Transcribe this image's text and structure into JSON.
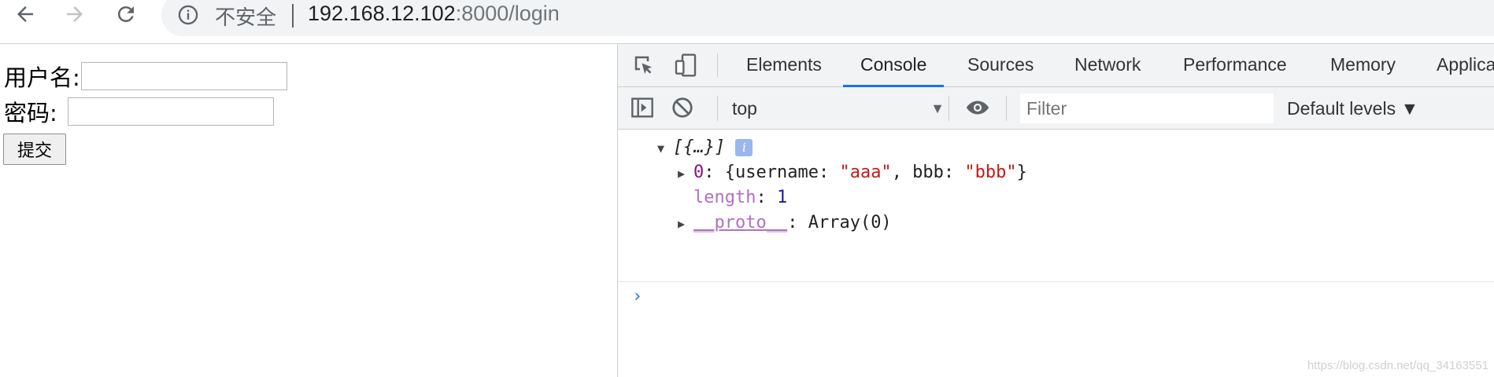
{
  "browser": {
    "security_label": "不安全",
    "url_host": "192.168.12.102",
    "url_path": ":8000/login"
  },
  "page": {
    "username_label": "用户名:",
    "password_label": "密码:",
    "username_value": "",
    "password_value": "",
    "submit_label": "提交"
  },
  "devtools": {
    "tabs": [
      "Elements",
      "Console",
      "Sources",
      "Network",
      "Performance",
      "Memory",
      "Applica"
    ],
    "active_tab": "Console",
    "context": "top",
    "filter_placeholder": "Filter",
    "levels_label": "Default levels ▼"
  },
  "console": {
    "summary": "[{…}]",
    "item0_key": "0",
    "item0_open": "{username: ",
    "item0_v1": "\"aaa\"",
    "item0_mid": ", bbb: ",
    "item0_v2": "\"bbb\"",
    "item0_close": "}",
    "length_key": "length",
    "length_val": "1",
    "proto_key": "__proto__",
    "proto_val": "Array(0)",
    "prompt": "›"
  },
  "watermark": "https://blog.csdn.net/qq_34163551",
  "colors": {
    "accent": "#1a73e8",
    "string_red": "#c41a16",
    "number_blue": "#1a1aa6",
    "key_purple": "#881280"
  }
}
